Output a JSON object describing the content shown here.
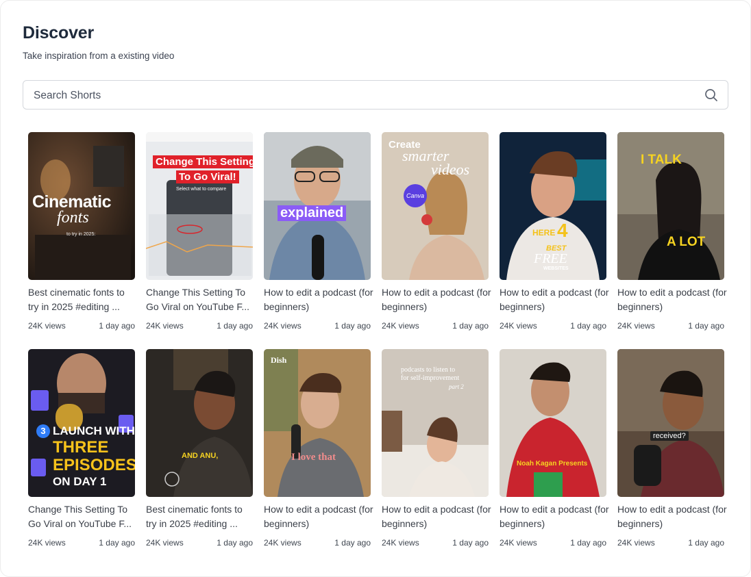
{
  "header": {
    "title": "Discover",
    "subtitle": "Take inspiration from a existing video"
  },
  "search": {
    "placeholder": "Search Shorts"
  },
  "videos": [
    {
      "title": "Best cinematic fonts to try in 2025  #editing ...",
      "views": "24K views",
      "age": "1 day ago",
      "overlay": {
        "line1": "Cinematic",
        "line2": "fonts",
        "line3": "to try in 2025:"
      }
    },
    {
      "title": "Change This Setting To Go Viral on YouTube F...",
      "views": "24K views",
      "age": "1 day ago",
      "overlay": {
        "line1": "Change This Setting",
        "line2": "To Go Viral!",
        "line3": "Select what to compare"
      }
    },
    {
      "title": "How to edit a podcast (for beginners)",
      "views": "24K views",
      "age": "1 day ago",
      "overlay": {
        "line1": "explained"
      }
    },
    {
      "title": "How to edit a podcast (for beginners)",
      "views": "24K views",
      "age": "1 day ago",
      "overlay": {
        "line1": "Create",
        "line2": "smarter",
        "line3": "videos",
        "badge": "Canva"
      }
    },
    {
      "title": "How to edit a podcast (for beginners)",
      "views": "24K views",
      "age": "1 day ago",
      "overlay": {
        "line1": "HERE",
        "line2": "4",
        "line3": "BEST",
        "line4": "FREE",
        "line5": "WEBSITES"
      }
    },
    {
      "title": "How to edit a podcast (for beginners)",
      "views": "24K views",
      "age": "1 day ago",
      "overlay": {
        "line1": "I TALK",
        "line2": "A LOT"
      }
    },
    {
      "title": "Change This Setting To Go Viral on YouTube F...",
      "views": "24K views",
      "age": "1 day ago",
      "overlay": {
        "line1": "LAUNCH WITH",
        "line2": "THREE",
        "line3": "EPISODES",
        "line4": "ON DAY 1",
        "badge": "3"
      }
    },
    {
      "title": "Best cinematic fonts to try in 2025  #editing ...",
      "views": "24K views",
      "age": "1 day ago",
      "overlay": {
        "line1": "AND ANU,"
      }
    },
    {
      "title": "How to edit a podcast (for beginners)",
      "views": "24K views",
      "age": "1 day ago",
      "overlay": {
        "line1": "I love that",
        "badge": "Dish"
      }
    },
    {
      "title": "How to edit a podcast (for beginners)",
      "views": "24K views",
      "age": "1 day ago",
      "overlay": {
        "line1": "podcasts to listen to",
        "line2": "for self-improvement",
        "line3": "part 2"
      }
    },
    {
      "title": "How to edit a podcast (for beginners)",
      "views": "24K views",
      "age": "1 day ago",
      "overlay": {
        "line1": "Noah Kagan Presents"
      }
    },
    {
      "title": "How to edit a podcast (for beginners)",
      "views": "24K views",
      "age": "1 day ago",
      "overlay": {
        "line1": "received?"
      }
    }
  ]
}
